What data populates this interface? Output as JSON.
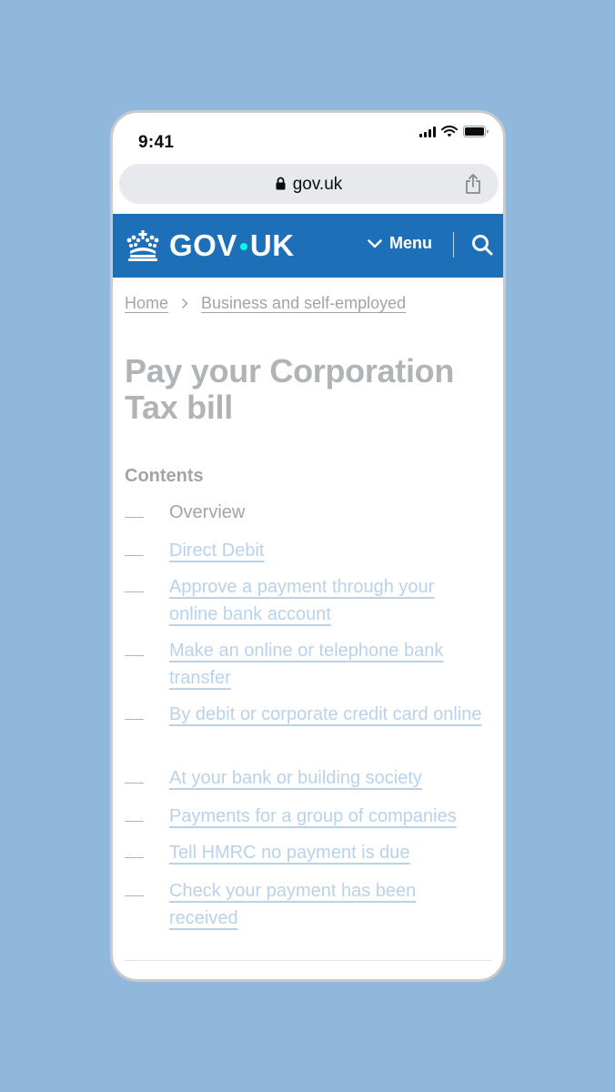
{
  "status_bar": {
    "time": "9:41"
  },
  "browser": {
    "url": "gov.uk"
  },
  "header": {
    "logo_left": "GOV",
    "logo_right": "UK",
    "menu_label": "Menu",
    "colors": {
      "background": "#1d70b8",
      "dot": "#00ffe0"
    }
  },
  "breadcrumb": [
    {
      "label": "Home"
    },
    {
      "label": "Business and self-employed"
    }
  ],
  "page_title": "Pay your Corporation Tax bill",
  "contents": {
    "heading": "Contents",
    "items": [
      {
        "label": "Overview",
        "current": true
      },
      {
        "label": "Direct Debit",
        "current": false
      },
      {
        "label": "Approve a payment through your online bank account",
        "current": false
      },
      {
        "label": "Make an online or telephone bank transfer",
        "current": false
      },
      {
        "label": "By debit or corporate credit card online",
        "current": false
      },
      {
        "label": "At your bank or building society",
        "current": false
      },
      {
        "label": "Payments for a group of companies",
        "current": false
      },
      {
        "label": "Tell HMRC no payment is due",
        "current": false
      },
      {
        "label": "Check your payment has been received",
        "current": false
      }
    ]
  },
  "icons": [
    "signal-icon",
    "wifi-icon",
    "battery-icon",
    "lock-icon",
    "share-icon",
    "crown-icon",
    "chevron-down-icon",
    "search-icon",
    "chevron-right-icon"
  ]
}
